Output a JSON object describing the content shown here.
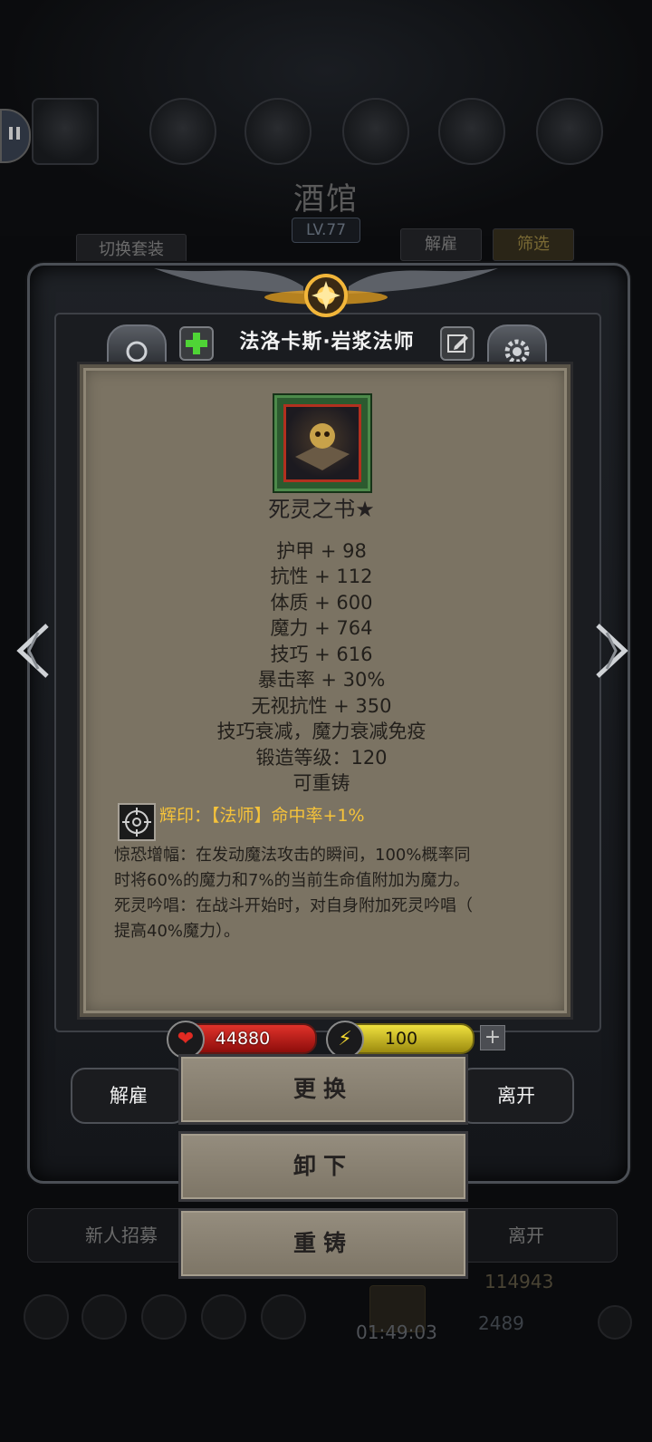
{
  "background": {
    "title": "酒馆",
    "level": "LV.77",
    "switch_outfit_label": "切换套装",
    "dismiss_tab_label": "解雇",
    "filter_tab_label": "筛选",
    "recruit_label": "新人招募",
    "leave_label": "离开",
    "gold": "114943",
    "timer": "01:49:03",
    "gems": "2489"
  },
  "modal": {
    "hero_name": "法洛卡斯·岩浆法师",
    "item": {
      "name": "死灵之书★",
      "stats": [
        "护甲 + 98",
        "抗性 + 112",
        "体质 + 600",
        "魔力 + 764",
        "技巧 + 616",
        "暴击率 + 30%",
        "无视抗性 + 350",
        "技巧衰减，魔力衰减免疫",
        "锻造等级：120",
        "可重铸"
      ],
      "rune": "辉印：【法师】命中率+1%",
      "description_lines": [
        "惊恐增幅：在发动魔法攻击的瞬间，100%概率同",
        "时将60%的魔力和7%的当前生命值附加为魔力。",
        "死灵吟唱：在战斗开始时，对自身附加死灵吟唱（",
        "提高40%魔力）。"
      ]
    },
    "hp": "44880",
    "energy": "100",
    "buttons": {
      "dismiss": "解雇",
      "leave": "离开",
      "replace": "更换",
      "unequip": "卸下",
      "reforge": "重铸"
    }
  },
  "colors": {
    "parchment": "#7b7363",
    "rune_text": "#f6c33a",
    "hp_bar": "#c8201a",
    "energy_bar": "#d9c92a"
  }
}
